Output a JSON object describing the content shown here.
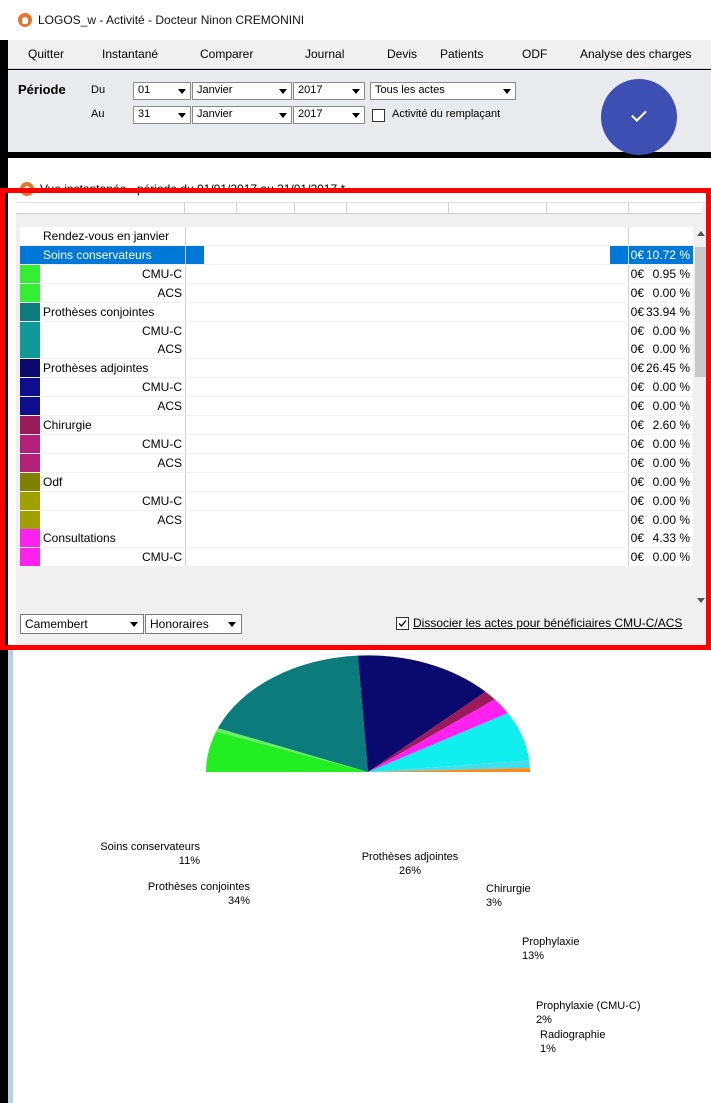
{
  "window": {
    "title": "LOGOS_w - Activité  - Docteur Ninon CREMONINI"
  },
  "menu": {
    "items": [
      "Quitter",
      "Instantané",
      "Comparer",
      "Journal",
      "Devis",
      "Patients",
      "ODF",
      "Analyse des charges"
    ]
  },
  "periode": {
    "label": "Période",
    "du_label": "Du",
    "au_label": "Au",
    "du_day": "01",
    "du_month": "Janvier",
    "du_year": "2017",
    "au_day": "31",
    "au_month": "Janvier",
    "au_year": "2017",
    "actes": "Tous les actes",
    "remplacant_label": "Activité du remplaçant",
    "remplacant_checked": false
  },
  "panel": {
    "title": "Vue instantanée - période du 01/01/2017 au 31/01/2017 *"
  },
  "table": {
    "rows": [
      {
        "label": "Rendez-vous en janvier",
        "indent": false,
        "color": "#ffffff",
        "amt": "",
        "pct": ""
      },
      {
        "label": "Soins conservateurs",
        "indent": false,
        "color": "#0078d7",
        "amt": "0€",
        "pct": "10.72 %",
        "selected": true
      },
      {
        "label": "CMU-C",
        "indent": true,
        "color": "#33ee33",
        "amt": "0€",
        "pct": "0.95 %"
      },
      {
        "label": "ACS",
        "indent": true,
        "color": "#33ee33",
        "amt": "0€",
        "pct": "0.00 %"
      },
      {
        "label": "Prothèses conjointes",
        "indent": false,
        "color": "#0b7b7b",
        "amt": "0€",
        "pct": "33.94 %"
      },
      {
        "label": "CMU-C",
        "indent": true,
        "color": "#119999",
        "amt": "0€",
        "pct": "0.00 %"
      },
      {
        "label": "ACS",
        "indent": true,
        "color": "#119999",
        "amt": "0€",
        "pct": "0.00 %"
      },
      {
        "label": "Prothèses adjointes",
        "indent": false,
        "color": "#0a0a6e",
        "amt": "0€",
        "pct": "26.45 %"
      },
      {
        "label": "CMU-C",
        "indent": true,
        "color": "#0d0d8f",
        "amt": "0€",
        "pct": "0.00 %"
      },
      {
        "label": "ACS",
        "indent": true,
        "color": "#0d0d8f",
        "amt": "0€",
        "pct": "0.00 %"
      },
      {
        "label": "Chirurgie",
        "indent": false,
        "color": "#9b1b5a",
        "amt": "0€",
        "pct": "2.60 %"
      },
      {
        "label": "CMU-C",
        "indent": true,
        "color": "#b3207a",
        "amt": "0€",
        "pct": "0.00 %"
      },
      {
        "label": "ACS",
        "indent": true,
        "color": "#b3207a",
        "amt": "0€",
        "pct": "0.00 %"
      },
      {
        "label": "Odf",
        "indent": false,
        "color": "#808000",
        "amt": "0€",
        "pct": "0.00 %"
      },
      {
        "label": "CMU-C",
        "indent": true,
        "color": "#a0a000",
        "amt": "0€",
        "pct": "0.00 %"
      },
      {
        "label": "ACS",
        "indent": true,
        "color": "#a0a000",
        "amt": "0€",
        "pct": "0.00 %"
      },
      {
        "label": "Consultations",
        "indent": false,
        "color": "#ff22ee",
        "amt": "0€",
        "pct": "4.33 %"
      },
      {
        "label": "CMU-C",
        "indent": true,
        "color": "#ff22ee",
        "amt": "0€",
        "pct": "0.00 %"
      }
    ]
  },
  "controls": {
    "chart_type": "Camembert",
    "measure": "Honoraires",
    "dissocier_label": "Dissocier les actes pour bénéficiaires CMU-C/ACS",
    "dissocier_checked": true
  },
  "chart_data": {
    "type": "pie",
    "title": "",
    "slices": [
      {
        "label": "Soins conservateurs",
        "pct_label": "11%",
        "value": 10.72,
        "color": "#22ee22"
      },
      {
        "label": "CMU-C",
        "pct_label": "",
        "value": 0.95,
        "color": "#66ee66"
      },
      {
        "label": "Prothèses conjointes",
        "pct_label": "34%",
        "value": 33.94,
        "color": "#0b7b7b"
      },
      {
        "label": "Prothèses adjointes",
        "pct_label": "26%",
        "value": 26.45,
        "color": "#0a0a6e"
      },
      {
        "label": "Chirurgie",
        "pct_label": "3%",
        "value": 2.6,
        "color": "#9b1b5a"
      },
      {
        "label": "Consultations",
        "pct_label": "",
        "value": 4.33,
        "color": "#ff22ee"
      },
      {
        "label": "Prophylaxie",
        "pct_label": "13%",
        "value": 13.0,
        "color": "#11eeee"
      },
      {
        "label": "Prophylaxie (CMU-C)",
        "pct_label": "2%",
        "value": 2.0,
        "color": "#44ddee"
      },
      {
        "label": "Radiographie",
        "pct_label": "1%",
        "value": 1.0,
        "color": "#ff8a14"
      }
    ]
  }
}
